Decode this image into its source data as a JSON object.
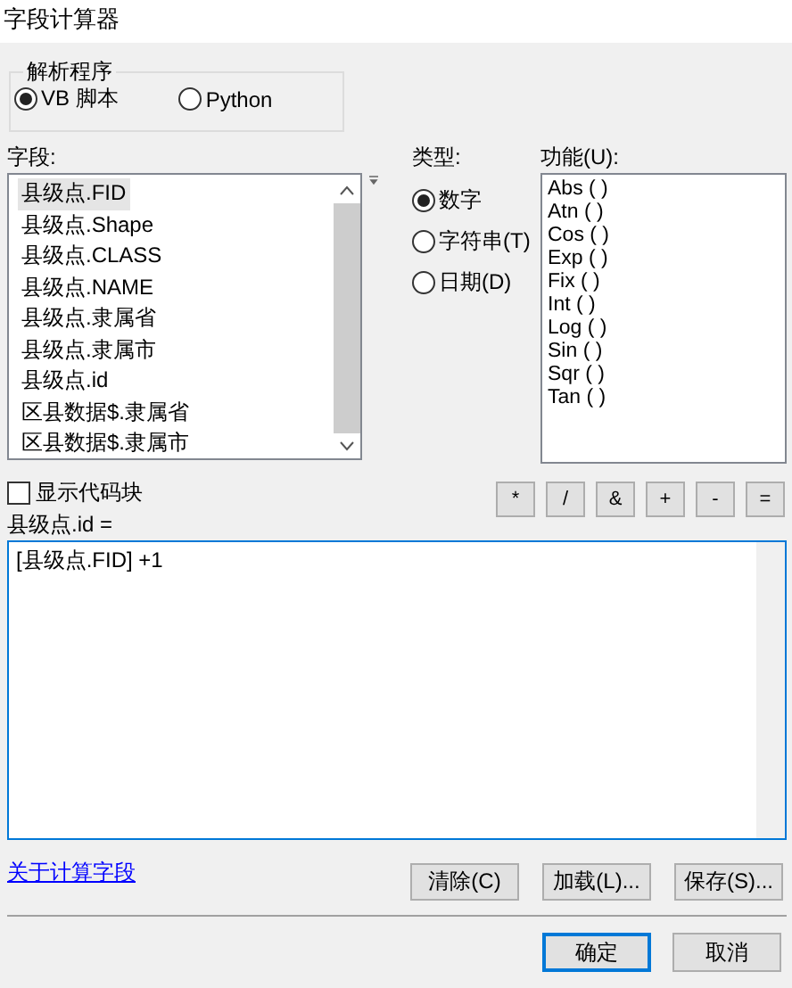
{
  "window": {
    "title": "字段计算器"
  },
  "parser": {
    "label": "解析程序",
    "options": [
      {
        "label": "VB 脚本",
        "selected": true
      },
      {
        "label": "Python",
        "selected": false
      }
    ]
  },
  "fields": {
    "label": "字段:",
    "items": [
      {
        "label": "县级点.FID",
        "selected": true
      },
      {
        "label": "县级点.Shape",
        "selected": false
      },
      {
        "label": "县级点.CLASS",
        "selected": false
      },
      {
        "label": "县级点.NAME",
        "selected": false
      },
      {
        "label": "县级点.隶属省",
        "selected": false
      },
      {
        "label": "县级点.隶属市",
        "selected": false
      },
      {
        "label": "县级点.id",
        "selected": false
      },
      {
        "label": "区县数据$.隶属省",
        "selected": false
      },
      {
        "label": "区县数据$.隶属市",
        "selected": false
      }
    ]
  },
  "type": {
    "label": "类型:",
    "options": [
      {
        "label": "数字",
        "selected": true
      },
      {
        "label": "字符串(T)",
        "selected": false
      },
      {
        "label": "日期(D)",
        "selected": false
      }
    ]
  },
  "functions": {
    "label": "功能(U):",
    "items": [
      "Abs ( )",
      "Atn ( )",
      "Cos ( )",
      "Exp ( )",
      "Fix ( )",
      "Int ( )",
      "Log ( )",
      "Sin ( )",
      "Sqr ( )",
      "Tan ( )"
    ]
  },
  "show_code_block": {
    "label": "显示代码块",
    "checked": false
  },
  "operators": [
    "*",
    "/",
    "&",
    "+",
    "-",
    "="
  ],
  "expression": {
    "label": "县级点.id =",
    "value": "[县级点.FID] +1"
  },
  "help_link": "关于计算字段",
  "file_buttons": [
    "清除(C)",
    "加载(L)...",
    "保存(S)..."
  ],
  "dialog_buttons": [
    {
      "label": "确定",
      "default": true
    },
    {
      "label": "取消",
      "default": false
    }
  ]
}
